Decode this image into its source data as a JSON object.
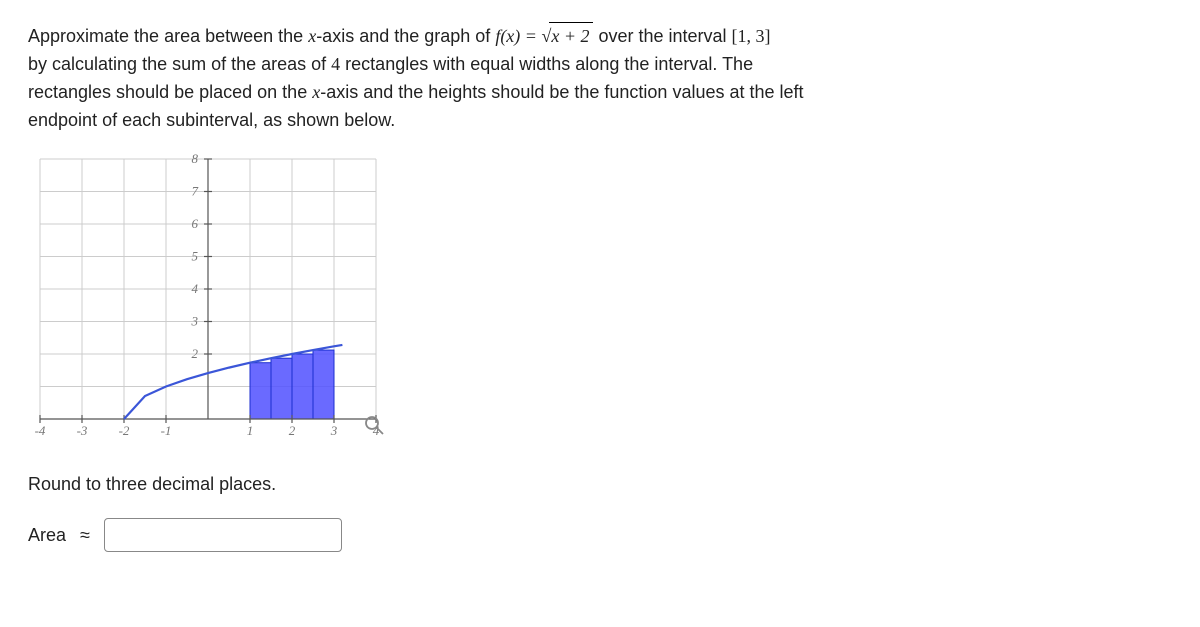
{
  "problem": {
    "pre_fx": "Approximate the area between the ",
    "xaxis": "x",
    "post_xaxis": "-axis and the graph of ",
    "fx_lhs": "f(x) = ",
    "sqrt_sym": "√",
    "sqrt_arg": "x + 2",
    "over": " over the interval ",
    "interval": "[1, 3]",
    "line2a": "by calculating the sum of the areas of ",
    "nrects": "4",
    "line2b": " rectangles with equal widths along the interval. The",
    "line3": "rectangles should be placed on the ",
    "line3b": "-axis and the heights should be the function values at the left",
    "line4": "endpoint of each subinterval, as shown below."
  },
  "round_instruction": "Round to three decimal places.",
  "answer": {
    "label": "Area",
    "symbol": "≈",
    "value": ""
  },
  "chart_data": {
    "type": "line+bar",
    "title": "",
    "xlabel": "",
    "ylabel": "",
    "xlim": [
      -4,
      4
    ],
    "ylim": [
      0,
      8
    ],
    "xticks": [
      -4,
      -3,
      -2,
      -1,
      1,
      2,
      3,
      4
    ],
    "yticks": [
      2,
      3,
      4,
      5,
      6,
      7,
      8
    ],
    "series": [
      {
        "name": "f(x)=sqrt(x+2)",
        "type": "line",
        "x": [
          -2,
          -1.5,
          -1,
          -0.5,
          0,
          0.5,
          1,
          1.5,
          2,
          2.5,
          3,
          3.2
        ],
        "y": [
          0,
          0.707,
          1,
          1.225,
          1.414,
          1.581,
          1.732,
          1.871,
          2,
          2.121,
          2.236,
          2.28
        ]
      }
    ],
    "rectangles": [
      {
        "x0": 1.0,
        "x1": 1.5,
        "h": 1.732
      },
      {
        "x0": 1.5,
        "x1": 2.0,
        "h": 1.871
      },
      {
        "x0": 2.0,
        "x1": 2.5,
        "h": 2.0
      },
      {
        "x0": 2.5,
        "x1": 3.0,
        "h": 2.121
      }
    ]
  }
}
